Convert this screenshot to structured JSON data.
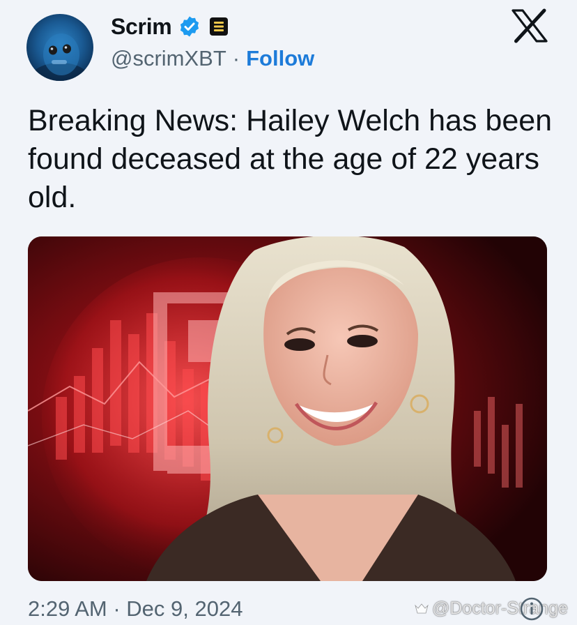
{
  "author": {
    "display_name": "Scrim",
    "handle": "@scrimXBT",
    "separator": "·",
    "follow_label": "Follow",
    "verified_badge_icon": "verified-badge-icon",
    "affiliate_icon": "affiliate-badge-icon"
  },
  "platform_icon": "x-logo-icon",
  "tweet": {
    "text": "Breaking News: Hailey Welch has been found deceased at the age of 22 years old."
  },
  "media": {
    "description_icon": "news-photo-image"
  },
  "timestamp": "2:29 AM · Dec 9, 2024",
  "watermark": "@Doctor-Strange",
  "colors": {
    "background": "#f1f4f9",
    "text_primary": "#0f1419",
    "text_secondary": "#536471",
    "link": "#1d7bd9",
    "verified": "#1d9bf0"
  }
}
